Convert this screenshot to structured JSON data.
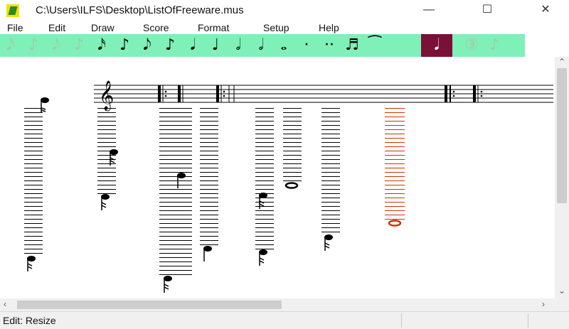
{
  "window": {
    "title": "C:\\Users\\ILFS\\Desktop\\ListOfFreeware.mus",
    "minimize": "—",
    "maximize": "☐",
    "close": "✕"
  },
  "menu": [
    "File",
    "Edit",
    "Draw",
    "Score",
    "Format",
    "Setup",
    "Help"
  ],
  "toolbar": {
    "tools": [
      {
        "glyph": "𝅘𝅥𝅯",
        "dim": true
      },
      {
        "glyph": "♪",
        "dim": true
      },
      {
        "glyph": "𝅘𝅥𝅮",
        "dim": true
      },
      {
        "glyph": "♪",
        "dim": true
      },
      {
        "glyph": "𝅘𝅥𝅯",
        "dim": false
      },
      {
        "glyph": "♪",
        "dim": false
      },
      {
        "glyph": "𝅘𝅥𝅮",
        "dim": false
      },
      {
        "glyph": "♪",
        "dim": false
      },
      {
        "glyph": "𝅘𝅥",
        "dim": false
      },
      {
        "glyph": "♩",
        "dim": false
      },
      {
        "glyph": "𝅗𝅥",
        "dim": false
      },
      {
        "glyph": "𝅗𝅥",
        "dim": false
      },
      {
        "glyph": "𝅝",
        "dim": false
      },
      {
        "glyph": "·",
        "dim": false
      },
      {
        "glyph": "··",
        "dim": false
      },
      {
        "glyph": "♬",
        "dim": false
      },
      {
        "glyph": "⁀",
        "dim": false
      },
      {
        "glyph": "𝅘𝅥",
        "dim": false,
        "selected": true
      },
      {
        "glyph": "③",
        "dim": true
      },
      {
        "glyph": "♪",
        "dim": true
      }
    ],
    "colors": {
      "background": "#7ff0b8",
      "selected": "#7a1036"
    }
  },
  "score": {
    "highlight_color": "#cc3300"
  },
  "status": {
    "text": "Edit: Resize"
  }
}
